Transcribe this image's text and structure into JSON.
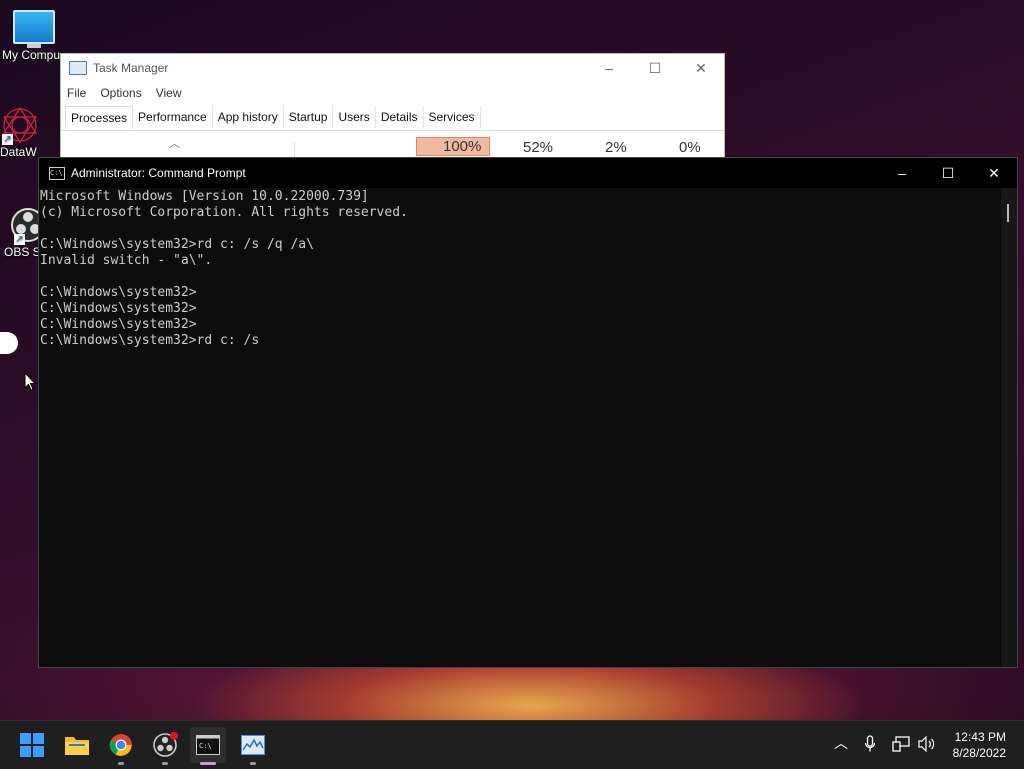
{
  "desktop": {
    "icons": [
      {
        "label": "My Compu",
        "icon": "monitor-icon"
      },
      {
        "label": "DataW",
        "icon": "datawrapper-icon"
      },
      {
        "label": "OBS S",
        "icon": "obs-icon"
      }
    ]
  },
  "task_manager": {
    "title": "Task Manager",
    "menu": [
      "File",
      "Options",
      "View"
    ],
    "tabs": [
      "Processes",
      "Performance",
      "App history",
      "Startup",
      "Users",
      "Details",
      "Services"
    ],
    "active_tab": "Processes",
    "column_stats": [
      "100%",
      "52%",
      "2%",
      "0%"
    ],
    "controls": {
      "minimize": "–",
      "maximize": "☐",
      "close": "✕"
    }
  },
  "cmd": {
    "title": "Administrator: Command Prompt",
    "lines": [
      "Microsoft Windows [Version 10.0.22000.739]",
      "(c) Microsoft Corporation. All rights reserved.",
      "",
      "C:\\Windows\\system32>rd c: /s /q /a\\",
      "Invalid switch - \"a\\\".",
      "",
      "C:\\Windows\\system32>",
      "C:\\Windows\\system32>",
      "C:\\Windows\\system32>",
      "C:\\Windows\\system32>rd c: /s"
    ],
    "controls": {
      "minimize": "–",
      "maximize": "☐",
      "close": "✕"
    }
  },
  "taskbar": {
    "apps": [
      {
        "name": "start-button",
        "icon": "windows-logo-icon"
      },
      {
        "name": "file-explorer",
        "icon": "folder-icon"
      },
      {
        "name": "chrome",
        "icon": "chrome-icon"
      },
      {
        "name": "obs-studio",
        "icon": "obs-icon"
      },
      {
        "name": "command-prompt",
        "icon": "terminal-icon"
      },
      {
        "name": "task-manager",
        "icon": "task-manager-icon"
      }
    ],
    "clock": {
      "time": "12:43 PM",
      "date": "8/28/2022"
    }
  }
}
